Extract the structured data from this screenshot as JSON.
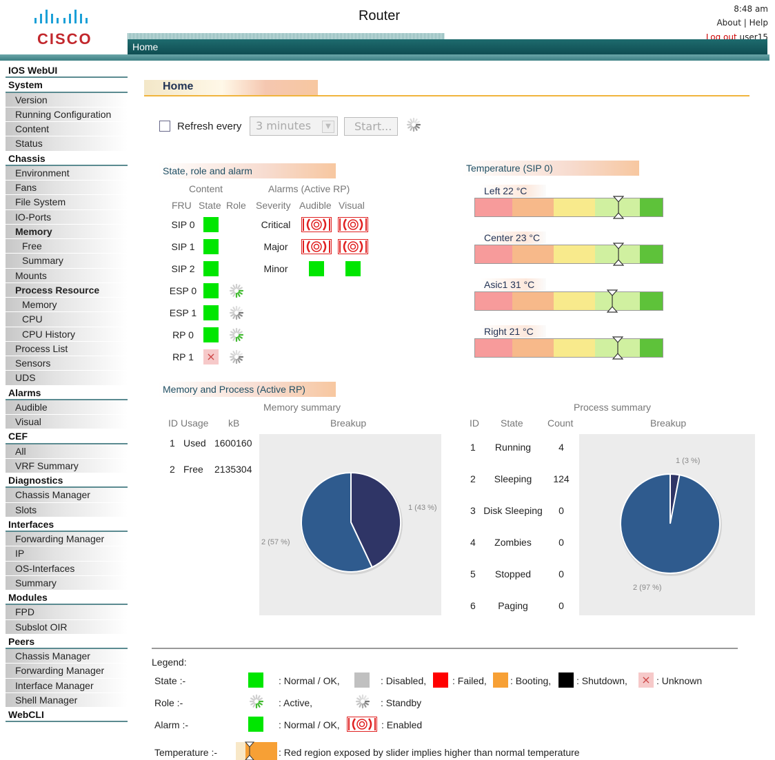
{
  "header": {
    "title": "Router",
    "time": "8:48 am",
    "about": "About",
    "help": "Help",
    "logout": "Log out",
    "user": "user15",
    "logo_text": "CISCO",
    "nav_home": "Home"
  },
  "sidebar": {
    "items": [
      {
        "label": "IOS WebUI",
        "level": "sec"
      },
      {
        "label": "System",
        "level": "sec"
      },
      {
        "label": "Version",
        "level": "l1"
      },
      {
        "label": "Running Configuration",
        "level": "l1"
      },
      {
        "label": "Content",
        "level": "l1"
      },
      {
        "label": "Status",
        "level": "l1"
      },
      {
        "label": "Chassis",
        "level": "sec"
      },
      {
        "label": "Environment",
        "level": "l1"
      },
      {
        "label": "Fans",
        "level": "l1"
      },
      {
        "label": "File System",
        "level": "l1"
      },
      {
        "label": "IO-Ports",
        "level": "l1"
      },
      {
        "label": "Memory",
        "level": "l1b"
      },
      {
        "label": "Free",
        "level": "l2"
      },
      {
        "label": "Summary",
        "level": "l2"
      },
      {
        "label": "Mounts",
        "level": "l1"
      },
      {
        "label": "Process Resource",
        "level": "l1b"
      },
      {
        "label": "Memory",
        "level": "l2"
      },
      {
        "label": "CPU",
        "level": "l2"
      },
      {
        "label": "CPU History",
        "level": "l2"
      },
      {
        "label": "Process List",
        "level": "l1"
      },
      {
        "label": "Sensors",
        "level": "l1"
      },
      {
        "label": "UDS",
        "level": "l1"
      },
      {
        "label": "Alarms",
        "level": "sec"
      },
      {
        "label": "Audible",
        "level": "l1"
      },
      {
        "label": "Visual",
        "level": "l1"
      },
      {
        "label": "CEF",
        "level": "sec"
      },
      {
        "label": "All",
        "level": "l1"
      },
      {
        "label": "VRF Summary",
        "level": "l1"
      },
      {
        "label": "Diagnostics",
        "level": "sec"
      },
      {
        "label": "Chassis Manager",
        "level": "l1"
      },
      {
        "label": "Slots",
        "level": "l1"
      },
      {
        "label": "Interfaces",
        "level": "sec"
      },
      {
        "label": "Forwarding Manager",
        "level": "l1"
      },
      {
        "label": "IP",
        "level": "l1"
      },
      {
        "label": "OS-Interfaces",
        "level": "l1"
      },
      {
        "label": "Summary",
        "level": "l1"
      },
      {
        "label": "Modules",
        "level": "sec"
      },
      {
        "label": "FPD",
        "level": "l1"
      },
      {
        "label": "Subslot OIR",
        "level": "l1"
      },
      {
        "label": "Peers",
        "level": "sec"
      },
      {
        "label": "Chassis Manager",
        "level": "l1"
      },
      {
        "label": "Forwarding Manager",
        "level": "l1"
      },
      {
        "label": "Interface Manager",
        "level": "l1"
      },
      {
        "label": "Shell Manager",
        "level": "l1"
      },
      {
        "label": "WebCLI",
        "level": "sec"
      }
    ]
  },
  "main": {
    "page_title": "Home",
    "refresh": {
      "label": "Refresh every",
      "select_value": "3 minutes",
      "start_label": "Start..."
    },
    "state_section": {
      "title": "State, role and alarm",
      "content_header": "Content",
      "alarms_header": "Alarms (Active RP)",
      "col_fru": "FRU",
      "col_state": "State",
      "col_role": "Role",
      "col_severity": "Severity",
      "col_audible": "Audible",
      "col_visual": "Visual",
      "frus": [
        {
          "name": "SIP 0",
          "state": "ok",
          "role": "none"
        },
        {
          "name": "SIP 1",
          "state": "ok",
          "role": "none"
        },
        {
          "name": "SIP 2",
          "state": "ok",
          "role": "none"
        },
        {
          "name": "ESP 0",
          "state": "ok",
          "role": "active"
        },
        {
          "name": "ESP 1",
          "state": "ok",
          "role": "standby"
        },
        {
          "name": "RP 0",
          "state": "ok",
          "role": "active"
        },
        {
          "name": "RP 1",
          "state": "unknown",
          "role": "standby"
        }
      ],
      "alarms": [
        {
          "severity": "Critical",
          "audible": "enabled",
          "visual": "enabled"
        },
        {
          "severity": "Major",
          "audible": "enabled",
          "visual": "enabled"
        },
        {
          "severity": "Minor",
          "audible": "ok",
          "visual": "ok"
        }
      ]
    },
    "temperature": {
      "title": "Temperature (SIP 0)",
      "sensors": [
        {
          "label": "Left 22 °C",
          "value": 22
        },
        {
          "label": "Center 23 °C",
          "value": 23
        },
        {
          "label": "Asic1 31 °C",
          "value": 31
        },
        {
          "label": "Right 21 °C",
          "value": 21
        }
      ]
    },
    "memproc": {
      "title": "Memory and Process (Active RP)",
      "memory_summary_title": "Memory summary",
      "mem_col_id": "ID",
      "mem_col_usage": "Usage",
      "mem_col_kb": "kB",
      "mem_col_breakup": "Breakup",
      "memory_rows": [
        {
          "id": "1",
          "usage": "Used",
          "kb": "1600160"
        },
        {
          "id": "2",
          "usage": "Free",
          "kb": "2135304"
        }
      ],
      "process_summary_title": "Process summary",
      "proc_col_id": "ID",
      "proc_col_state": "State",
      "proc_col_count": "Count",
      "proc_col_breakup": "Breakup",
      "process_rows": [
        {
          "id": "1",
          "state": "Running",
          "count": "4"
        },
        {
          "id": "2",
          "state": "Sleeping",
          "count": "124"
        },
        {
          "id": "3",
          "state": "Disk Sleeping",
          "count": "0"
        },
        {
          "id": "4",
          "state": "Zombies",
          "count": "0"
        },
        {
          "id": "5",
          "state": "Stopped",
          "count": "0"
        },
        {
          "id": "6",
          "state": "Paging",
          "count": "0"
        }
      ],
      "memory_pie": {
        "slices": [
          {
            "label": "1 (43 %)",
            "value": 43
          },
          {
            "label": "2 (57 %)",
            "value": 57
          }
        ]
      },
      "process_pie": {
        "slices": [
          {
            "label": "1 (3 %)",
            "value": 3
          },
          {
            "label": "2 (97 %)",
            "value": 97
          }
        ]
      }
    },
    "legend": {
      "title": "Legend:",
      "state_label": "State :-",
      "state_ok": ": Normal / OK,",
      "state_disabled": ": Disabled,",
      "state_failed": ": Failed,",
      "state_booting": ": Booting,",
      "state_shutdown": ": Shutdown,",
      "state_unknown": ": Unknown",
      "role_label": "Role :-",
      "role_active": ": Active,",
      "role_standby": ": Standby",
      "alarm_label": "Alarm :-",
      "alarm_ok": ": Normal / OK,",
      "alarm_enabled": ": Enabled",
      "temp_label": "Temperature :-",
      "temp_text": ": Red region exposed by slider implies higher than normal temperature"
    }
  },
  "colors": {
    "ok": "#00e600",
    "disabled": "#c0c0c0",
    "failed": "#ff0000",
    "booting": "#f7a035",
    "shutdown": "#000000",
    "unknown": "#f6c9c9",
    "nav": "#1e6b6e",
    "pie_dark": "#2f3566",
    "pie_blue": "#2f5b8e"
  }
}
